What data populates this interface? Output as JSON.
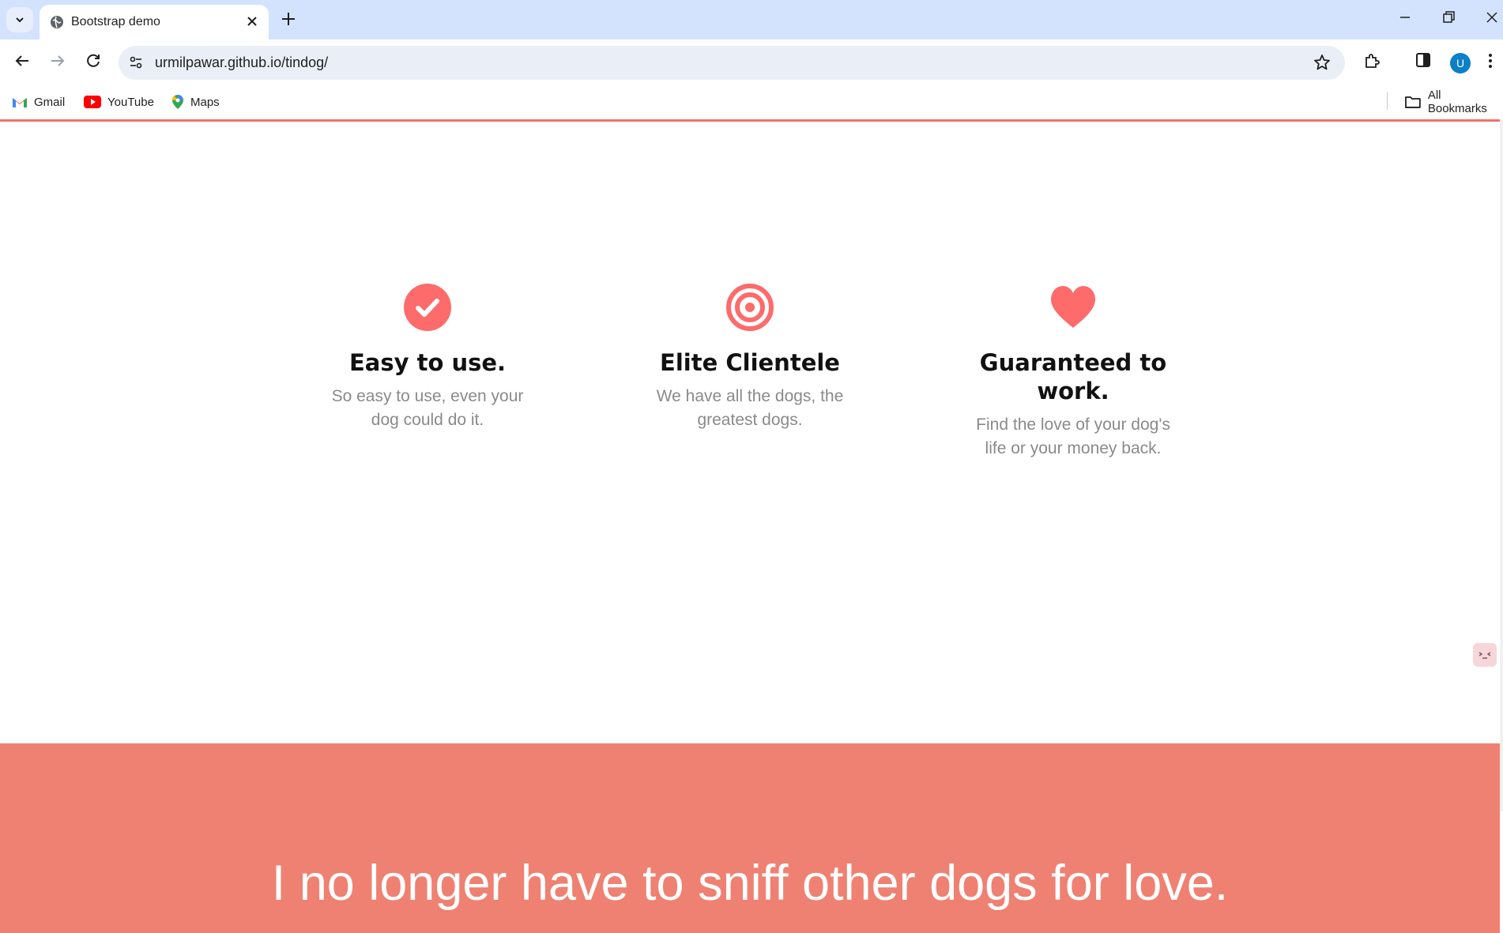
{
  "browser": {
    "tab": {
      "title": "Bootstrap demo"
    },
    "url": "urmilpawar.github.io/tindog/",
    "avatar_letter": "U",
    "bookmarks": [
      {
        "label": "Gmail",
        "icon": "gmail-icon"
      },
      {
        "label": "YouTube",
        "icon": "youtube-icon"
      },
      {
        "label": "Maps",
        "icon": "maps-icon"
      }
    ],
    "all_bookmarks_label": "All Bookmarks"
  },
  "features": [
    {
      "icon": "check-circle-icon",
      "title": "Easy to use.",
      "desc_line1": "So easy to use, even your",
      "desc_line2": "dog could do it."
    },
    {
      "icon": "bullseye-icon",
      "title": "Elite Clientele",
      "desc_line1": "We have all the dogs, the",
      "desc_line2": "greatest dogs."
    },
    {
      "icon": "heart-icon",
      "title_line1": "Guaranteed to",
      "title_line2": "work.",
      "desc_line1": "Find the love of your dog's",
      "desc_line2": "life or your money back."
    }
  ],
  "testimonial": {
    "text": "I no longer have to sniff other dogs for love."
  },
  "colors": {
    "accent": "#ef8172",
    "icon": "#fd6b6b",
    "heading": "#111111",
    "muted": "#8a8a8a"
  }
}
